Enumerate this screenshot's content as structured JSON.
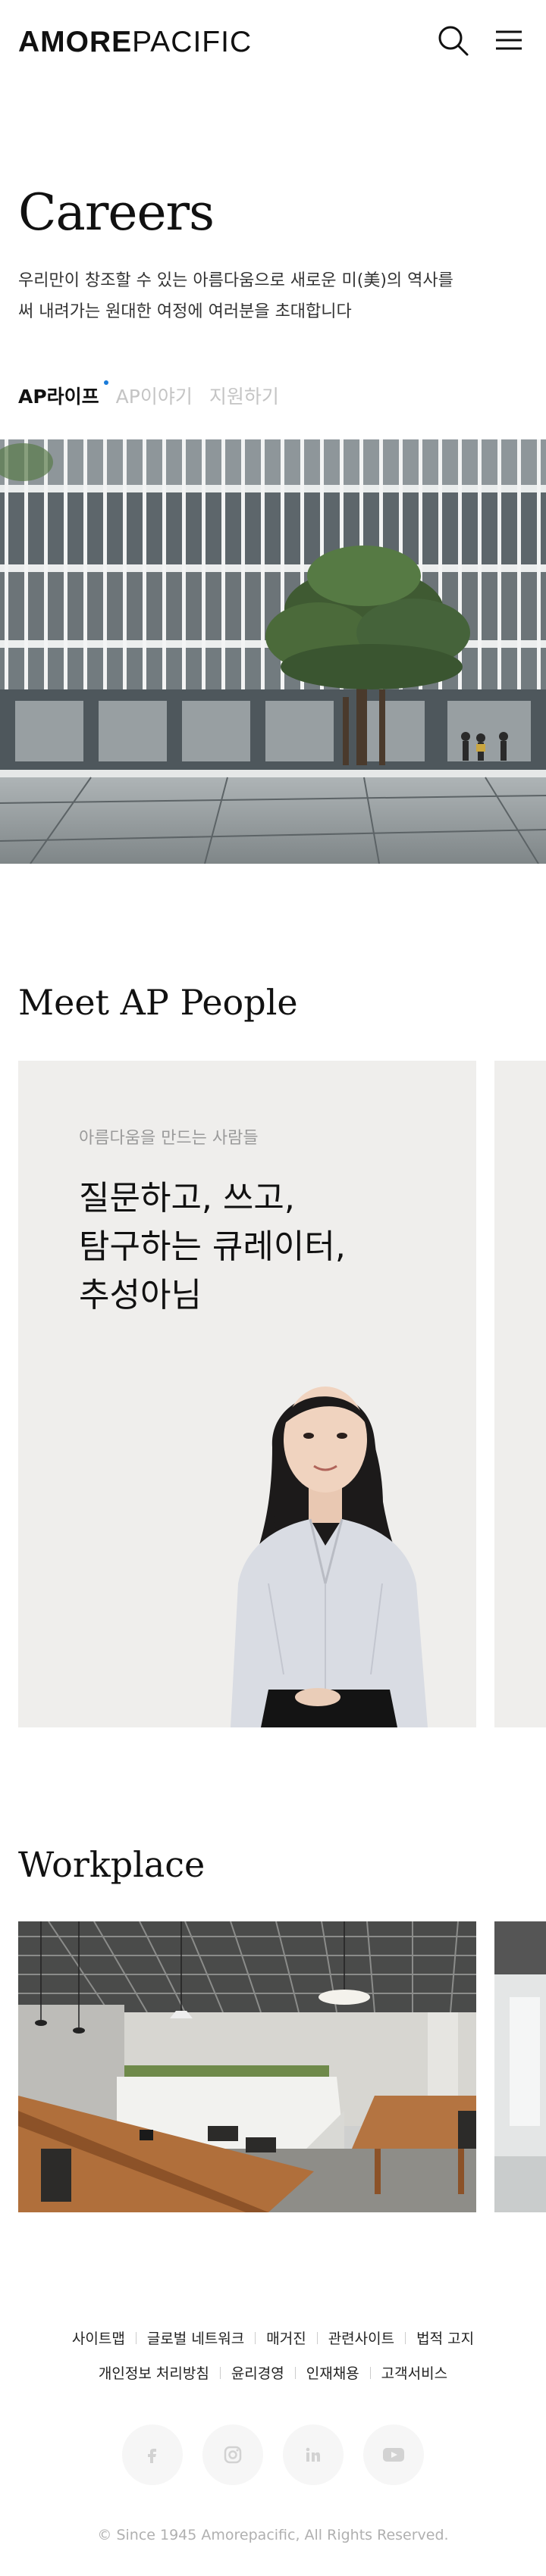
{
  "header": {
    "logo_bold": "AMORE",
    "logo_light": "PACIFIC",
    "search_icon": "search-icon",
    "menu_icon": "hamburger-menu-icon"
  },
  "intro": {
    "title": "Careers",
    "description_line1": "우리만이 창조할 수 있는 아름다움으로 새로운 미(美)의 역사를",
    "description_line2": "써 내려가는 원대한 여정에 여러분을 초대합니다"
  },
  "tabs": [
    {
      "label": "AP라이프",
      "active": true
    },
    {
      "label": "AP이야기",
      "active": false
    },
    {
      "label": "지원하기",
      "active": false
    }
  ],
  "meet": {
    "title": "Meet AP People",
    "card": {
      "eyebrow": "아름다움을 만드는 사람들",
      "headline_line1": "질문하고, 쓰고,",
      "headline_line2": "탐구하는 큐레이터,",
      "headline_line3": "추성아님"
    }
  },
  "workplace": {
    "title": "Workplace"
  },
  "footer": {
    "links_row1": [
      "사이트맵",
      "글로벌 네트워크",
      "매거진",
      "관련사이트",
      "법적 고지"
    ],
    "links_row2": [
      "개인정보 처리방침",
      "윤리경영",
      "인재채용",
      "고객서비스"
    ],
    "social": [
      "facebook-icon",
      "instagram-icon",
      "linkedin-icon",
      "youtube-icon"
    ],
    "copyright": "© Since 1945 Amorepacific, All Rights Reserved."
  },
  "colors": {
    "accent": "#1a7bd9",
    "card_bg": "#efeeec",
    "text": "#111111",
    "muted": "#c4c4c4"
  }
}
